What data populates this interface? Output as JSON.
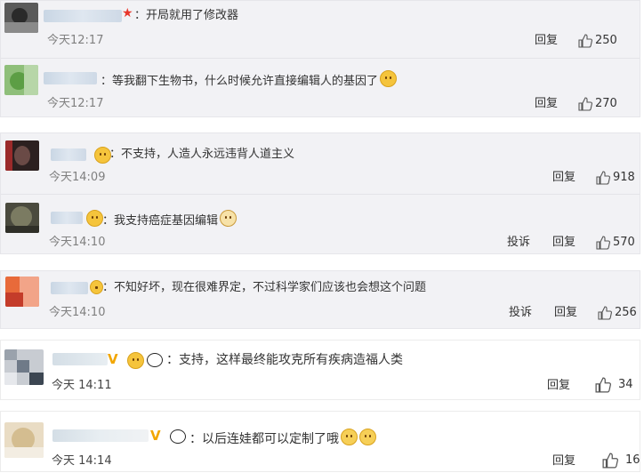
{
  "comments": [
    {
      "text": "：开局就用了修改器",
      "time": "今天12:17",
      "reply_label": "回复",
      "likes": "250",
      "badge": "★",
      "badge_color": "#e8352a"
    },
    {
      "text": "：等我翻下生物书，什么时候允许直接编辑人的基因了",
      "time": "今天12:17",
      "reply_label": "回复",
      "likes": "270"
    },
    {
      "text": "：不支持，人造人永远违背人道主义",
      "time": "今天14:09",
      "reply_label": "回复",
      "likes": "918"
    },
    {
      "text": "：我支持癌症基因编辑",
      "time": "今天14:10",
      "report_label": "投诉",
      "reply_label": "回复",
      "likes": "570"
    },
    {
      "text": "：不知好坏，现在很难界定，不过科学家们应该也会想这个问题",
      "time": "今天14:10",
      "report_label": "投诉",
      "reply_label": "回复",
      "likes": "256"
    },
    {
      "text": "：支持，这样最终能攻克所有疾病造福人类",
      "time": "今天 14:11",
      "reply_label": "回复",
      "likes": "34",
      "v_mark": "V"
    },
    {
      "text": "：以后连娃都可以定制了哦",
      "time": "今天 14:14",
      "reply_label": "回复",
      "likes": "16",
      "v_mark": "V"
    }
  ]
}
